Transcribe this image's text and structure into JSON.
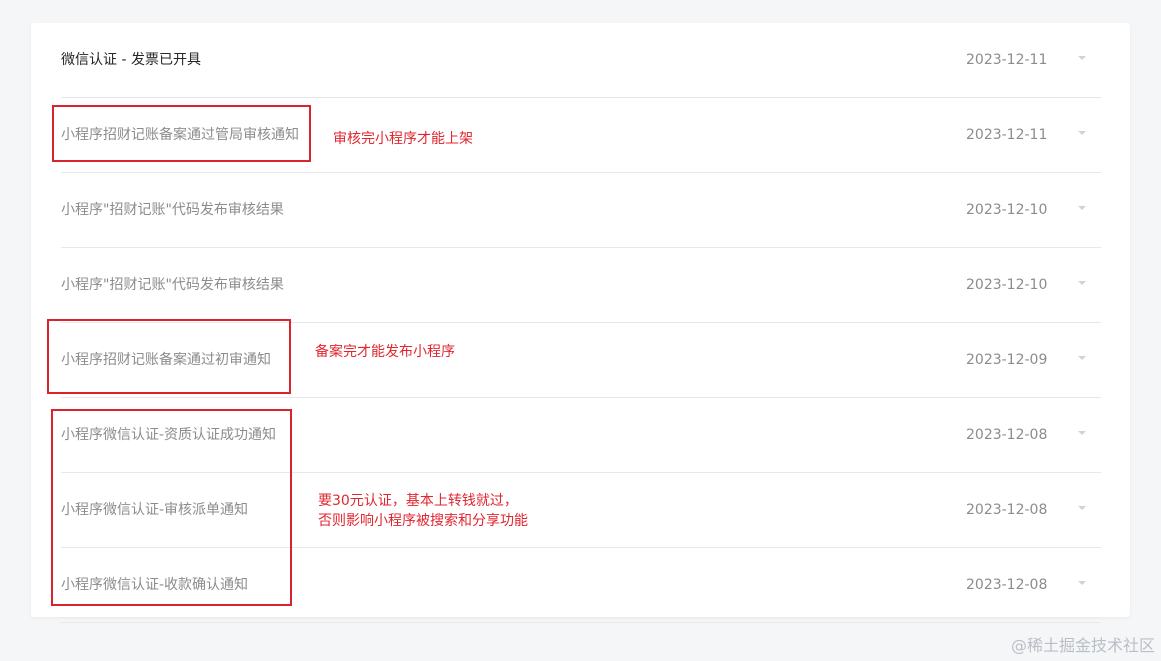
{
  "messages": [
    {
      "title": "微信认证 - 发票已开具",
      "date": "2023-12-11"
    },
    {
      "title": "小程序招财记账备案通过管局审核通知",
      "date": "2023-12-11"
    },
    {
      "title": "小程序\"招财记账\"代码发布审核结果",
      "date": "2023-12-10"
    },
    {
      "title": "小程序\"招财记账\"代码发布审核结果",
      "date": "2023-12-10"
    },
    {
      "title": "小程序招财记账备案通过初审通知",
      "date": "2023-12-09"
    },
    {
      "title": "小程序微信认证-资质认证成功通知",
      "date": "2023-12-08"
    },
    {
      "title": "小程序微信认证-审核派单通知",
      "date": "2023-12-08"
    },
    {
      "title": "小程序微信认证-收款确认通知",
      "date": "2023-12-08"
    }
  ],
  "annotations": {
    "note_review": "审核完小程序才能上架",
    "note_filing": "备案完才能发布小程序",
    "note_cert_line1": "要30元认证，基本上转钱就过，",
    "note_cert_line2": "否则影响小程序被搜索和分享功能"
  },
  "colors": {
    "annotation_red": "#d9232d",
    "unread_text": "#262626",
    "read_text": "#8c8c8c"
  },
  "icons": {
    "expand": "chevron-down-icon"
  },
  "watermark": "@稀土掘金技术社区"
}
